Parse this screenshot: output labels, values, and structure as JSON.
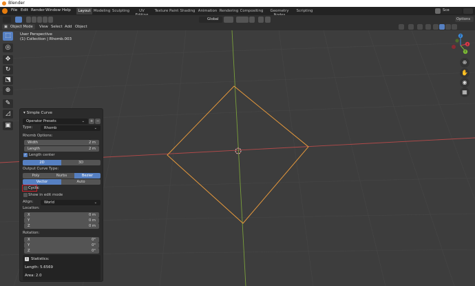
{
  "window": {
    "title": "Blender"
  },
  "menu": {
    "items": [
      "File",
      "Edit",
      "Render",
      "Window",
      "Help"
    ]
  },
  "workspaces": {
    "tabs": [
      "Layout",
      "Modeling",
      "Sculpting",
      "UV Editing",
      "Texture Paint",
      "Shading",
      "Animation",
      "Rendering",
      "Compositing",
      "Geometry Nodes",
      "Scripting"
    ],
    "active": "Layout",
    "scene_label": "Sce"
  },
  "header": {
    "transform_orientation": "Global",
    "mode": "Object Mode",
    "menus": [
      "View",
      "Select",
      "Add",
      "Object"
    ],
    "options_label": "Options"
  },
  "viewport": {
    "view_name": "User Perspective",
    "collection_info": "(1) Collection | Rhomb.003",
    "gizmo": {
      "x": "X",
      "y": "Y",
      "z": "Z"
    }
  },
  "operator_panel": {
    "title": "Simple Curve",
    "presets": "Operator Presets",
    "type_label": "Type:",
    "type_value": "Rhomb",
    "rhomb_options_label": "Rhomb Options:",
    "width_label": "Width",
    "width_value": "2 m",
    "length_label": "Length",
    "length_value": "2 m",
    "length_center": "Length center",
    "dim_2d": "2D",
    "dim_3d": "3D",
    "output_curve_type_label": "Output Curve Type:",
    "curve_types": [
      "Poly",
      "Nurbs",
      "Bezier"
    ],
    "handle_types": [
      "Vector",
      "Auto"
    ],
    "cyclic": "Cyclic",
    "show_in_edit_mode": "Show in edit mode",
    "align_label": "Align:",
    "align_value": "World",
    "location_label": "Location:",
    "location": [
      {
        "axis": "X",
        "value": "0 m"
      },
      {
        "axis": "Y",
        "value": "0 m"
      },
      {
        "axis": "Z",
        "value": "0 m"
      }
    ],
    "rotation_label": "Rotation:",
    "rotation": [
      {
        "axis": "X",
        "value": "0°"
      },
      {
        "axis": "Y",
        "value": "0°"
      },
      {
        "axis": "Z",
        "value": "0°"
      }
    ],
    "statistics_label": "Statistics:",
    "stat_length": "Length: 5.6569",
    "stat_area": "Area: 2.0"
  },
  "colors": {
    "accent": "#5680c2",
    "curve": "#e89a3c",
    "x_axis": "#b34a4a",
    "y_axis": "#7aa03b",
    "highlight_box": "#d0202a",
    "gizmo_x": "#e0394a",
    "gizmo_y": "#7dbd36",
    "gizmo_z": "#3b8de0"
  }
}
